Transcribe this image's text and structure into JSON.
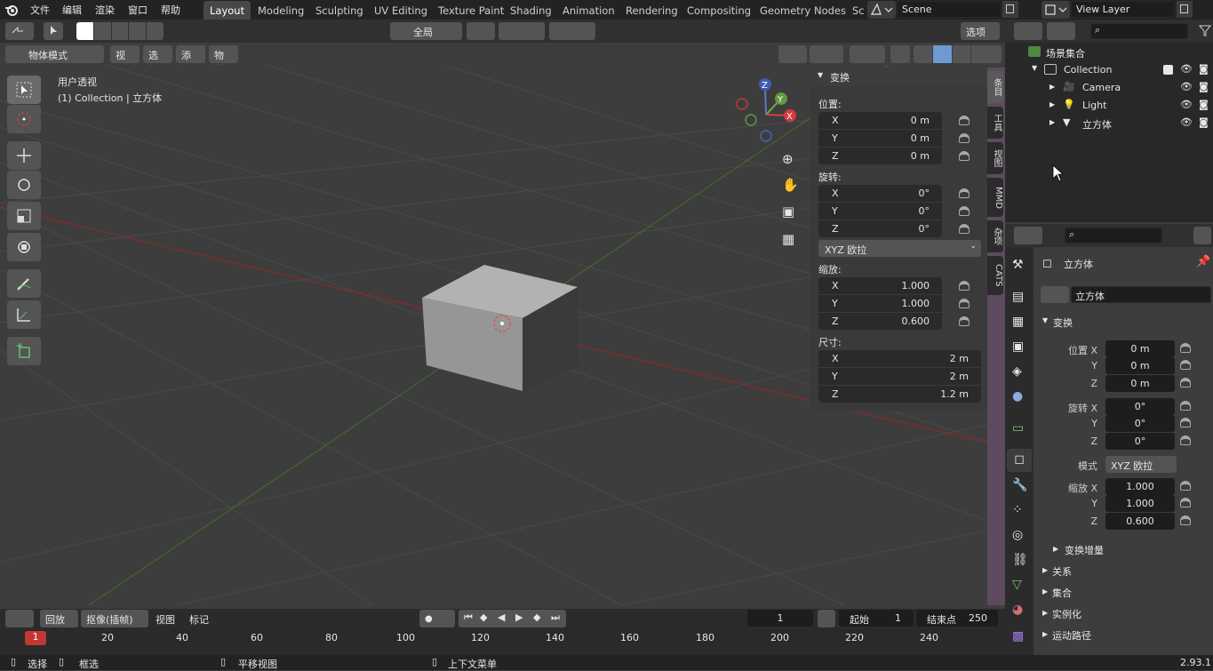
{
  "topbar": {
    "menus": [
      "文件",
      "编辑",
      "渲染",
      "窗口",
      "帮助"
    ],
    "workspaces": [
      "Layout",
      "Modeling",
      "Sculpting",
      "UV Editing",
      "Texture Paint",
      "Shading",
      "Animation",
      "Rendering",
      "Compositing",
      "Geometry Nodes",
      "Sc"
    ],
    "active_workspace": "Layout",
    "scene": "Scene",
    "view_layer": "View Layer"
  },
  "header": {
    "global_label": "全局",
    "options_label": "选项",
    "mode_label": "物体模式",
    "menus": [
      "视图",
      "选择",
      "添加",
      "物体"
    ]
  },
  "viewport": {
    "view_name": "用户透视",
    "collection_info": "(1) Collection | 立方体",
    "gizmo_axes": [
      "Z",
      "Y",
      "X"
    ]
  },
  "n_panel": {
    "title": "变换",
    "location_label": "位置:",
    "location": [
      {
        "k": "X",
        "v": "0 m"
      },
      {
        "k": "Y",
        "v": "0 m"
      },
      {
        "k": "Z",
        "v": "0 m"
      }
    ],
    "rotation_label": "旋转:",
    "rotation": [
      {
        "k": "X",
        "v": "0°"
      },
      {
        "k": "Y",
        "v": "0°"
      },
      {
        "k": "Z",
        "v": "0°"
      }
    ],
    "rotation_mode": "XYZ 欧拉",
    "scale_label": "缩放:",
    "scale": [
      {
        "k": "X",
        "v": "1.000"
      },
      {
        "k": "Y",
        "v": "1.000"
      },
      {
        "k": "Z",
        "v": "0.600"
      }
    ],
    "dimensions_label": "尺寸:",
    "dimensions": [
      {
        "k": "X",
        "v": "2 m"
      },
      {
        "k": "Y",
        "v": "2 m"
      },
      {
        "k": "Z",
        "v": "1.2 m"
      }
    ],
    "tabs": [
      "条目",
      "工具",
      "视图",
      "MMD",
      "杂项",
      "CATS"
    ]
  },
  "outliner": {
    "scene_collection": "场景集合",
    "collection": "Collection",
    "items": [
      "Camera",
      "Light",
      "立方体"
    ]
  },
  "properties": {
    "object_name_header": "立方体",
    "object_name_field": "立方体",
    "transform_label": "变换",
    "location": [
      {
        "k": "位置 X",
        "v": "0 m"
      },
      {
        "k": "Y",
        "v": "0 m"
      },
      {
        "k": "Z",
        "v": "0 m"
      }
    ],
    "rotation": [
      {
        "k": "旋转 X",
        "v": "0°"
      },
      {
        "k": "Y",
        "v": "0°"
      },
      {
        "k": "Z",
        "v": "0°"
      }
    ],
    "mode_key": "模式",
    "mode_val": "XYZ 欧拉",
    "scale": [
      {
        "k": "缩放 X",
        "v": "1.000"
      },
      {
        "k": "Y",
        "v": "1.000"
      },
      {
        "k": "Z",
        "v": "0.600"
      }
    ],
    "delta_transform": "变换增量",
    "categories": [
      "关系",
      "集合",
      "实例化",
      "运动路径"
    ]
  },
  "timeline": {
    "playback": "回放",
    "keying": "抠像(插帧)",
    "view": "视图",
    "marker": "标记",
    "current_frame": "1",
    "start_label": "起始",
    "start": "1",
    "end_label": "结束点",
    "end": "250",
    "ruler": [
      "20",
      "40",
      "60",
      "80",
      "100",
      "120",
      "140",
      "160",
      "180",
      "200",
      "220",
      "240"
    ],
    "ruler_current": "1"
  },
  "status": {
    "select": "选择",
    "box_select": "框选",
    "pan_view": "平移视图",
    "context_menu": "上下文菜单",
    "version": "2.93.1"
  }
}
